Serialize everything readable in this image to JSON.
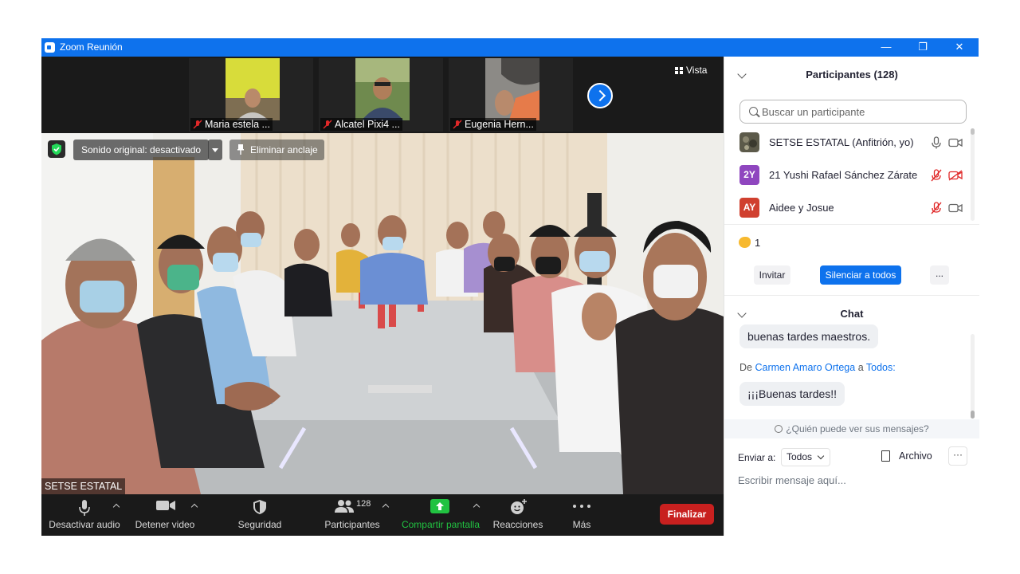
{
  "window": {
    "title": "Zoom Reunión",
    "controls": {
      "minimize": "—",
      "restore": "❐",
      "close": "✕"
    }
  },
  "thumbnails": [
    {
      "name": "Maria estela ...",
      "muted": true
    },
    {
      "name": "Alcatel Pixi4 ...",
      "muted": true
    },
    {
      "name": "Eugenia Hern...",
      "muted": true
    }
  ],
  "view_label": "Vista",
  "main_video": {
    "sound_label": "Sonido original: desactivado",
    "unpin_label": "Eliminar anclaje",
    "speaker_name": "SETSE ESTATAL"
  },
  "toolbar": {
    "mute": "Desactivar audio",
    "video": "Detener video",
    "security": "Seguridad",
    "participants": "Participantes",
    "participants_count": "128",
    "share": "Compartir pantalla",
    "reactions": "Reacciones",
    "more": "Más",
    "end": "Finalizar"
  },
  "participants_panel": {
    "title": "Participantes (128)",
    "search_placeholder": "Buscar un participante",
    "people": [
      {
        "initials": "",
        "name": "SETSE ESTATAL (Anfitrión, yo)",
        "mic": "on",
        "cam": "on"
      },
      {
        "initials": "2Y",
        "name": "21 Yushi Rafael Sánchez Zárate",
        "mic": "muted",
        "cam": "off",
        "color": "#8f46bf"
      },
      {
        "initials": "AY",
        "name": "Aidee y Josue",
        "mic": "muted",
        "cam": "on",
        "color": "#d0402f"
      }
    ],
    "reaction_count": "1",
    "invite": "Invitar",
    "mute_all": "Silenciar a todos",
    "more": "..."
  },
  "chat": {
    "title": "Chat",
    "prev_message": "buenas tardes maestros.",
    "from_prefix": "De",
    "from_name": "Carmen Amaro Ortega",
    "to_word": "a",
    "to_name": "Todos:",
    "message": "¡¡¡Buenas tardes!!",
    "who_can_see": "¿Quién puede ver sus mensajes?",
    "send_to_label": "Enviar a:",
    "send_to_value": "Todos",
    "file_label": "Archivo",
    "more": "···",
    "input_placeholder": "Escribir mensaje aquí..."
  },
  "colors": {
    "brand": "#0e72ed",
    "end": "#c8201f",
    "share": "#21c241",
    "muted": "#e02828"
  }
}
